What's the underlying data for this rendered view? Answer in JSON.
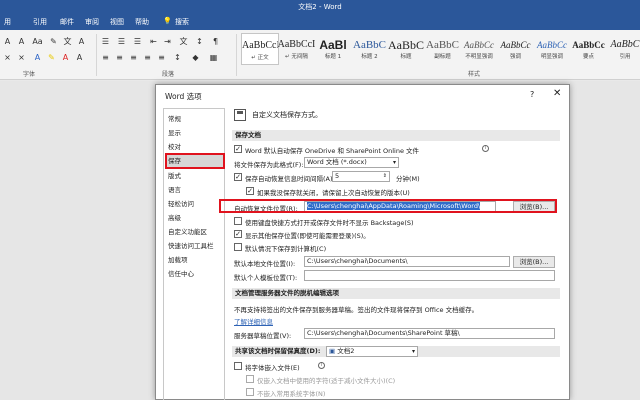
{
  "app": {
    "title": "文档2 - Word",
    "menu_tabs": [
      "用",
      "引用",
      "邮件",
      "审阅",
      "视图",
      "帮助",
      "搜索"
    ],
    "search_icon": "lightbulb-icon",
    "ribbon": {
      "font_group_label": "字体",
      "paragraph_group_label": "段落",
      "styles_group_label": "样式",
      "styles": [
        {
          "sample": "AaBbCcI",
          "name": "↵ 正文"
        },
        {
          "sample": "AaBbCcI",
          "name": "↵ 无间隔"
        },
        {
          "sample": "AaBl",
          "name": "标题 1"
        },
        {
          "sample": "AaBbC",
          "name": "标题 2"
        },
        {
          "sample": "AaBbC",
          "name": "标题"
        },
        {
          "sample": "AaBbC",
          "name": "副标题"
        },
        {
          "sample": "AaBbCc",
          "name": "不明显强调"
        },
        {
          "sample": "AaBbCc",
          "name": "强调"
        },
        {
          "sample": "AaBbCc",
          "name": "明显强调"
        },
        {
          "sample": "AaBbCc",
          "name": "要点"
        },
        {
          "sample": "AaBbC",
          "name": "引用"
        }
      ]
    }
  },
  "dialog": {
    "title": "Word 选项",
    "help": "?",
    "close": "✕",
    "nav": [
      "常规",
      "显示",
      "校对",
      "保存",
      "版式",
      "语言",
      "轻松访问",
      "高级",
      "自定义功能区",
      "快速访问工具栏",
      "加载项",
      "信任中心"
    ],
    "active_nav": "保存",
    "header": "自定义文档保存方式。",
    "save_docs": {
      "section_title": "保存文档",
      "autosave_label": "Word 默认自动保存 OneDrive 和 SharePoint Online 文件",
      "format_label": "将文件保存为此格式(F):",
      "format_value": "Word 文档 (*.docx)",
      "autorecover_label": "保存自动恢复信息时间间隔(A)",
      "autorecover_minutes": "5",
      "minutes_label": "分钟(M)",
      "keep_last_label": "如果我没保存就关闭，请保留上次自动恢复的版本(U)",
      "recover_location_label": "自动恢复文件位置(R):",
      "recover_location_value": "C:\\Users\\chenghai\\AppData\\Roaming\\Microsoft\\Word\\",
      "browse_label": "浏览(B)...",
      "backstage_label": "使用键盘快捷方式打开或保存文件时不显示 Backstage(S)",
      "show_other_label": "显示其他保存位置(即使可能需要登录)(S)。",
      "default_local_label": "默认情况下保存到计算机(C)",
      "default_local_path_label": "默认本地文件位置(I):",
      "default_local_path_value": "C:\\Users\\chenghai\\Documents\\",
      "browse2_label": "浏览(B)...",
      "personal_template_label": "默认个人模板位置(T):",
      "personal_template_value": ""
    },
    "offline": {
      "section_title": "文档管理服务器文件的脱机编辑选项",
      "note": "不再支持将签出的文件保存到服务器草稿。签出的文件现将保存到 Office 文档缓存。",
      "link": "了解详细信息",
      "drafts_label": "服务器草稿位置(V):",
      "drafts_value": "C:\\Users\\chenghai\\Documents\\SharePoint 草稿\\"
    },
    "fidelity": {
      "section_title": "共享该文档时保留保真度(D):",
      "doc_value": "文档2",
      "embed_fonts_label": "将字体嵌入文件(E)",
      "embed_subset_label": "仅嵌入文档中使用的字符(适于减小文件大小)(C)",
      "no_common_label": "不嵌入常用系统字体(N)"
    }
  }
}
